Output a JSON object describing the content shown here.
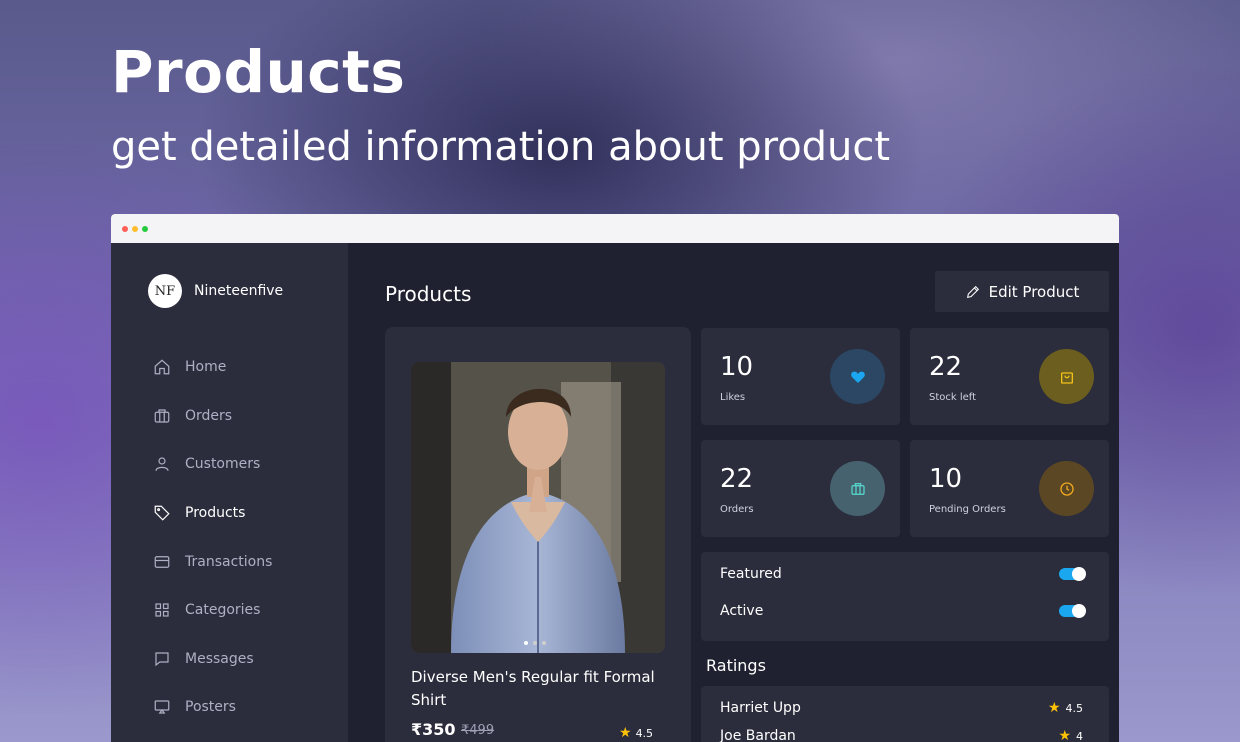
{
  "hero": {
    "title": "Products",
    "subtitle": "get detailed information about product"
  },
  "window_dots": [
    "#ff5f56",
    "#ffbd2e",
    "#27c93f"
  ],
  "brand": {
    "logo_text": "NF",
    "name": "Nineteenfive"
  },
  "nav": [
    {
      "label": "Home",
      "icon": "home-icon",
      "active": false
    },
    {
      "label": "Orders",
      "icon": "briefcase-icon",
      "active": false
    },
    {
      "label": "Customers",
      "icon": "user-icon",
      "active": false
    },
    {
      "label": "Products",
      "icon": "tag-icon",
      "active": true
    },
    {
      "label": "Transactions",
      "icon": "card-icon",
      "active": false
    },
    {
      "label": "Categories",
      "icon": "grid-icon",
      "active": false
    },
    {
      "label": "Messages",
      "icon": "message-icon",
      "active": false
    },
    {
      "label": "Posters",
      "icon": "monitor-icon",
      "active": false
    }
  ],
  "main": {
    "title": "Products",
    "edit_button": "Edit Product"
  },
  "product": {
    "name": "Diverse Men's Regular fit Formal Shirt",
    "price": "₹350",
    "old_price": "₹499",
    "rating": "4.5",
    "image_alt": "product-photo"
  },
  "stats": [
    {
      "value": "10",
      "label": "Likes",
      "icon": "heart-icon",
      "bg": "#2b4763",
      "fg": "#1aa7f0"
    },
    {
      "value": "22",
      "label": "Stock left",
      "icon": "bag-icon",
      "bg": "#6b5e1e",
      "fg": "#f2c21b"
    },
    {
      "value": "22",
      "label": "Orders",
      "icon": "briefcase-icon",
      "bg": "#46626f",
      "fg": "#56d1c7"
    },
    {
      "value": "10",
      "label": "Pending Orders",
      "icon": "clock-icon",
      "bg": "#5b4724",
      "fg": "#f0a81e"
    }
  ],
  "toggles": [
    {
      "label": "Featured",
      "on": true
    },
    {
      "label": "Active",
      "on": true
    }
  ],
  "ratings": {
    "title": "Ratings",
    "items": [
      {
        "name": "Harriet Upp",
        "score": "4.5"
      },
      {
        "name": "Joe Bardan",
        "score": "4"
      }
    ]
  }
}
